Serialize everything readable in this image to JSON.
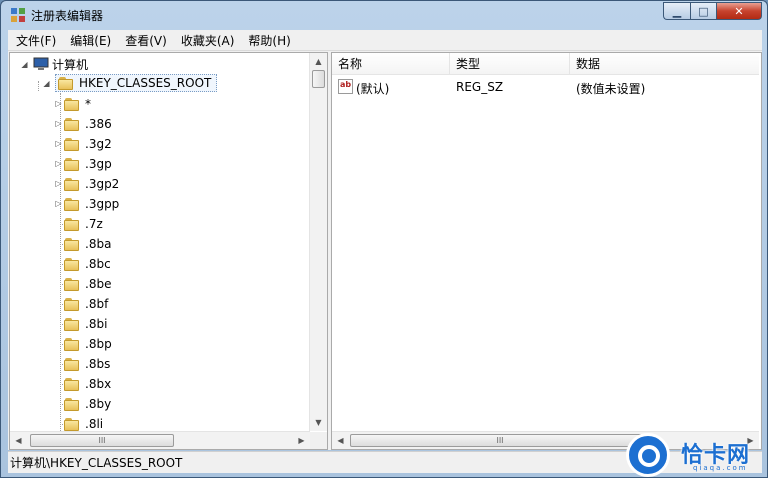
{
  "window": {
    "title": "注册表编辑器"
  },
  "menu": [
    "文件(F)",
    "编辑(E)",
    "查看(V)",
    "收藏夹(A)",
    "帮助(H)"
  ],
  "tree": {
    "computer_label": "计算机",
    "root_key": "HKEY_CLASSES_ROOT",
    "children": [
      {
        "name": "*",
        "expandable": true
      },
      {
        "name": ".386",
        "expandable": true
      },
      {
        "name": ".3g2",
        "expandable": true
      },
      {
        "name": ".3gp",
        "expandable": true
      },
      {
        "name": ".3gp2",
        "expandable": true
      },
      {
        "name": ".3gpp",
        "expandable": true
      },
      {
        "name": ".7z",
        "expandable": false
      },
      {
        "name": ".8ba",
        "expandable": false
      },
      {
        "name": ".8bc",
        "expandable": false
      },
      {
        "name": ".8be",
        "expandable": false
      },
      {
        "name": ".8bf",
        "expandable": false
      },
      {
        "name": ".8bi",
        "expandable": false
      },
      {
        "name": ".8bp",
        "expandable": false
      },
      {
        "name": ".8bs",
        "expandable": false
      },
      {
        "name": ".8bx",
        "expandable": false
      },
      {
        "name": ".8by",
        "expandable": false
      },
      {
        "name": ".8li",
        "expandable": false
      }
    ]
  },
  "values": {
    "columns": [
      "名称",
      "类型",
      "数据"
    ],
    "rows": [
      {
        "name": "(默认)",
        "type": "REG_SZ",
        "data": "(数值未设置)",
        "icon": "ab-string-icon"
      }
    ]
  },
  "scroll": {
    "thumb_glyph": "III"
  },
  "status": {
    "path": "计算机\\HKEY_CLASSES_ROOT"
  },
  "watermark": {
    "brand": "恰卡网",
    "domain": "qiaqa.com"
  }
}
